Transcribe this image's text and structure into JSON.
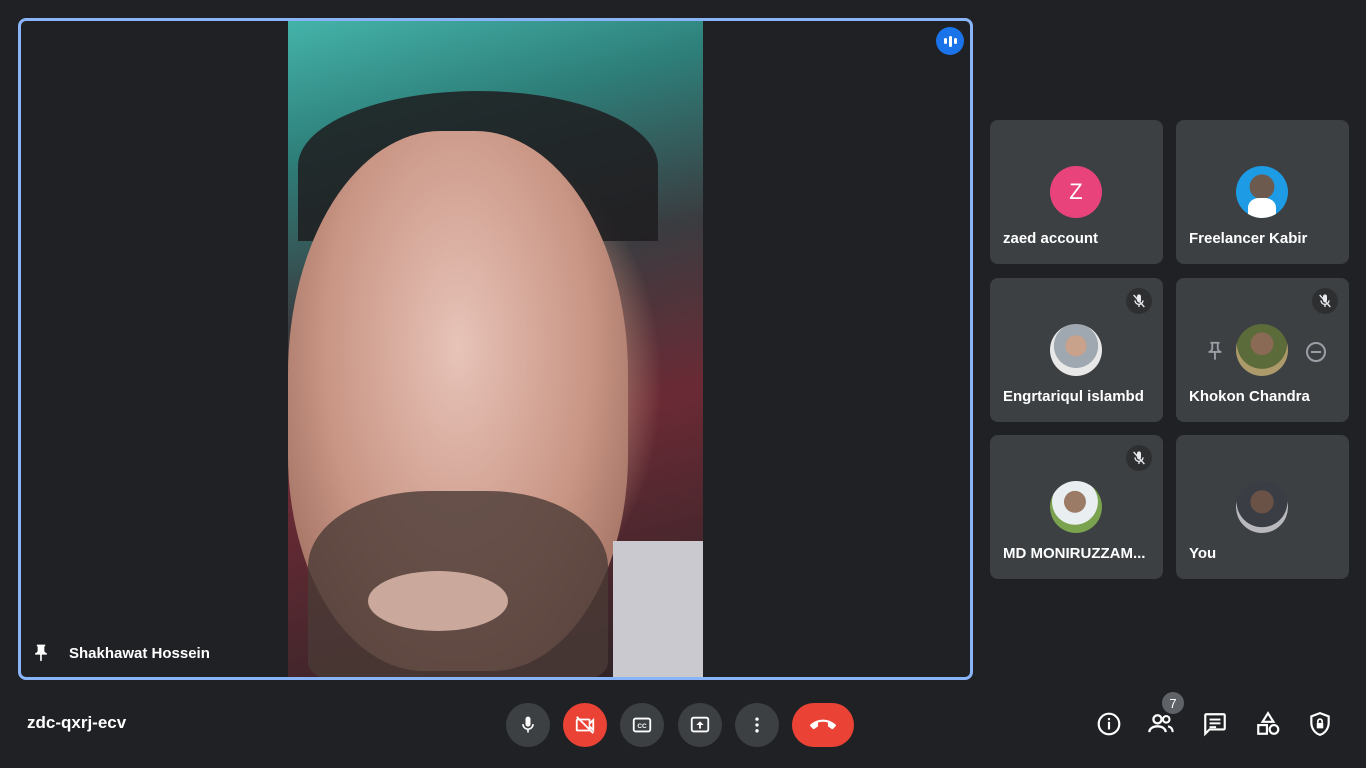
{
  "main": {
    "speaker_name": "Shakhawat Hossein"
  },
  "participants": [
    {
      "name": "zaed account",
      "avatar_letter": "Z",
      "muted": false
    },
    {
      "name": "Freelancer Kabir",
      "muted": false
    },
    {
      "name": "Engrtariqul islambd",
      "muted": true
    },
    {
      "name": "Khokon Chandra",
      "muted": true
    },
    {
      "name": "MD MONIRUZZAM...",
      "muted": true
    },
    {
      "name": "You",
      "muted": false
    }
  ],
  "bottom_bar": {
    "meeting_code": "zdc-qxrj-ecv",
    "participant_count": "7"
  },
  "colors": {
    "background": "#202124",
    "tile": "#3c4043",
    "active_border": "#8ab4f8",
    "danger": "#ea4335",
    "accent": "#1a73e8"
  },
  "icons": {
    "mic": "mic-icon",
    "camera": "camera-off-icon",
    "captions": "captions-icon",
    "present": "present-screen-icon",
    "more": "more-options-icon",
    "leave": "end-call-icon",
    "info": "info-icon",
    "people": "people-icon",
    "chat": "chat-icon",
    "activities": "activities-icon",
    "host": "host-controls-icon"
  }
}
